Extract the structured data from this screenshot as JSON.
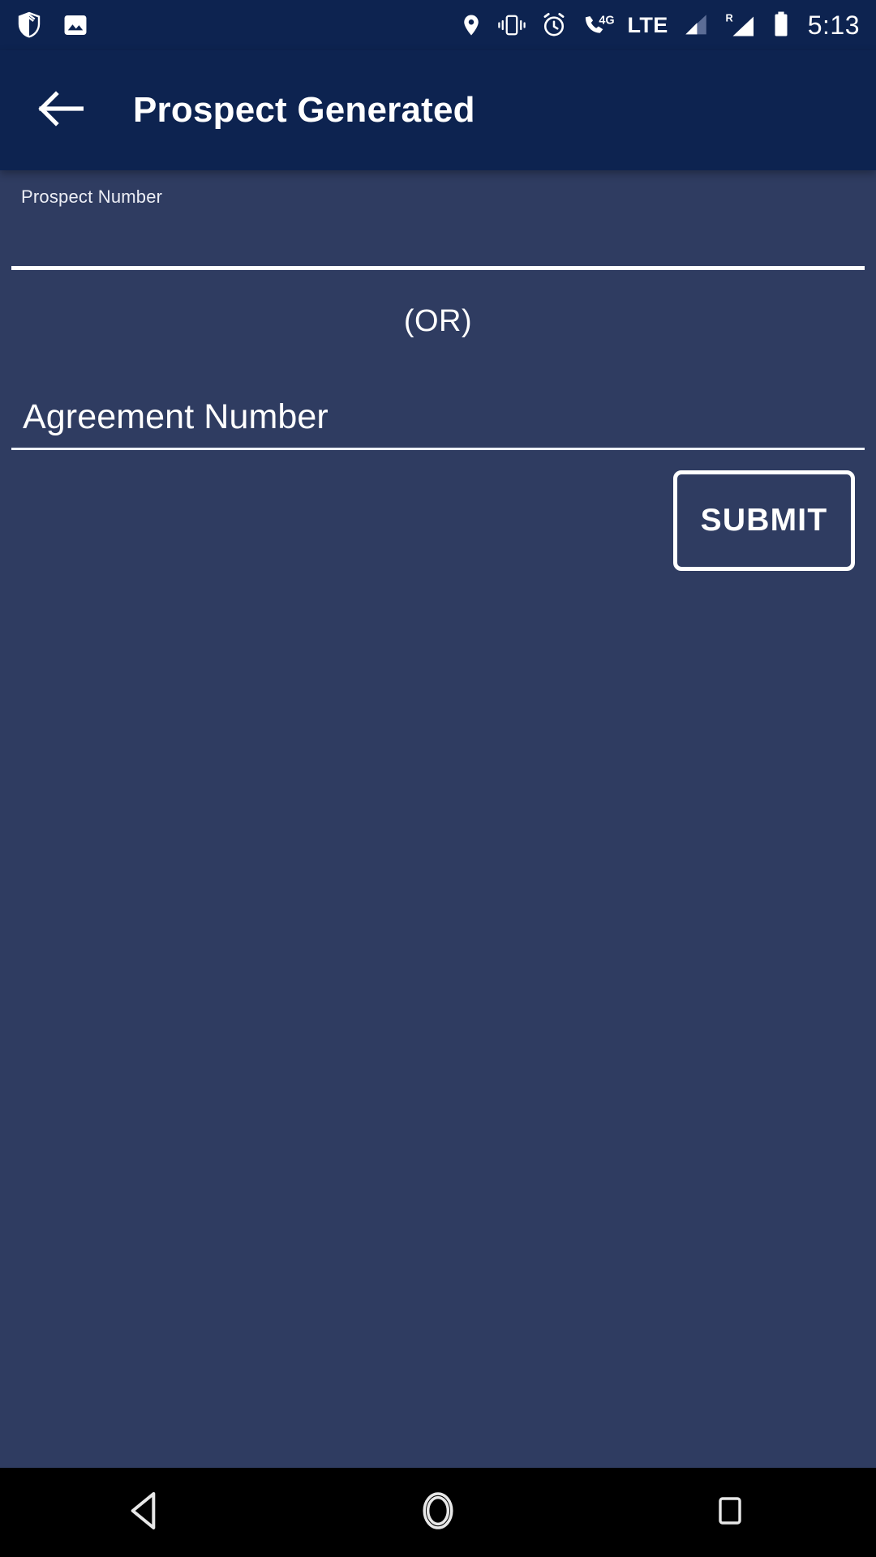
{
  "statusbar": {
    "left_icons": [
      {
        "name": "shield-security-icon"
      },
      {
        "name": "image-screenshot-icon"
      }
    ],
    "right_icons": [
      {
        "name": "location-pin-icon"
      },
      {
        "name": "vibrate-icon"
      },
      {
        "name": "alarm-clock-icon"
      },
      {
        "name": "phone-4g-icon"
      }
    ],
    "network_label": "LTE",
    "roaming_label": "R",
    "clock": "5:13",
    "battery": "full"
  },
  "appbar": {
    "back_icon": "arrow-left-icon",
    "title": "Prospect Generated",
    "background": "#0d2350"
  },
  "form": {
    "prospect_field": {
      "label": "Prospect Number",
      "value": "",
      "placeholder": "Prospect Number",
      "state": "focused"
    },
    "separator_text": "(OR)",
    "agreement_field": {
      "label": "Agreement Number",
      "value": "",
      "placeholder": "Agreement Number",
      "state": "empty"
    },
    "submit_label": "SUBMIT"
  },
  "navbar": {
    "back_label": "back-triangle-icon",
    "home_label": "home-circle-icon",
    "recents_label": "recents-square-icon"
  },
  "colors": {
    "appbar": "#0d2350",
    "body": "#2f3c61",
    "accent": "#ffffff",
    "navbar": "#000000"
  }
}
